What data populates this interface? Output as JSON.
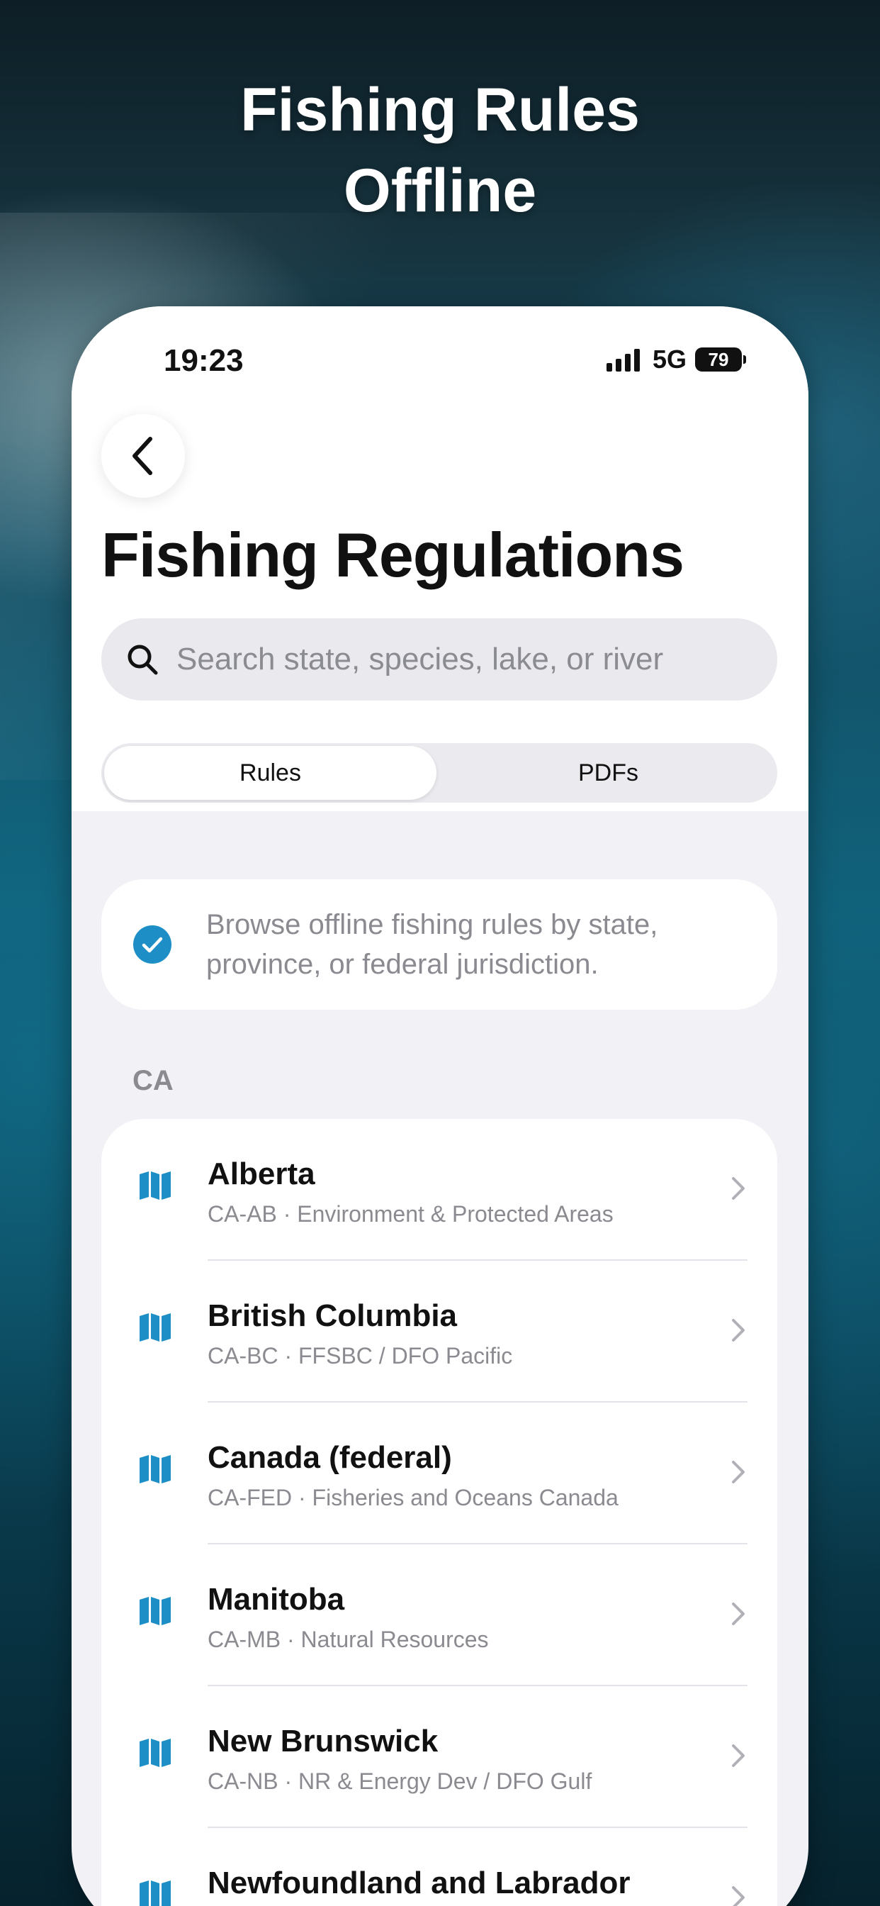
{
  "headline": {
    "line1": "Fishing Rules",
    "line2": "Offline"
  },
  "status_bar": {
    "time": "19:23",
    "network": "5G",
    "battery": "79"
  },
  "page": {
    "title": "Fishing Regulations"
  },
  "search": {
    "placeholder": "Search state, species, lake, or river"
  },
  "tabs": [
    {
      "label": "Rules",
      "active": true
    },
    {
      "label": "PDFs",
      "active": false
    }
  ],
  "info": {
    "text": "Browse offline fishing rules by state, province, or federal jurisdiction."
  },
  "section": {
    "label": "CA"
  },
  "jurisdictions": [
    {
      "name": "Alberta",
      "subtitle": "CA-AB · Environment & Protected Areas"
    },
    {
      "name": "British Columbia",
      "subtitle": "CA-BC · FFSBC / DFO Pacific"
    },
    {
      "name": "Canada (federal)",
      "subtitle": "CA-FED · Fisheries and Oceans Canada"
    },
    {
      "name": "Manitoba",
      "subtitle": "CA-MB · Natural Resources"
    },
    {
      "name": "New Brunswick",
      "subtitle": "CA-NB · NR & Energy Dev / DFO Gulf"
    },
    {
      "name": "Newfoundland and Labrador",
      "subtitle": ""
    }
  ],
  "colors": {
    "accent": "#1d8fc6",
    "text_primary": "#111111",
    "text_secondary": "#8a8a90",
    "background": "#f2f2f6"
  },
  "icons": {
    "back": "chevron-left-icon",
    "search": "magnifier-icon",
    "info": "checkmark-circle-icon",
    "row": "map-icon",
    "row_action": "chevron-right-icon"
  }
}
